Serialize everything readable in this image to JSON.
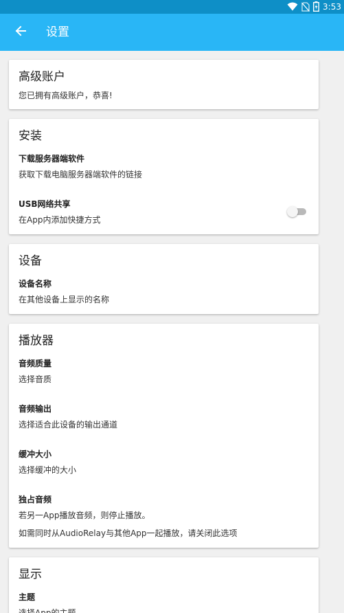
{
  "status_bar": {
    "time": "3:53",
    "icons": [
      "wifi-icon",
      "no-sim-icon",
      "battery-icon"
    ]
  },
  "app_bar": {
    "title": "设置",
    "back_icon": "arrow-left-icon"
  },
  "colors": {
    "status_bar": "#0e8fc7",
    "app_bar": "#29b6f6",
    "background": "#f0f0f0",
    "card": "#ffffff"
  },
  "sections": {
    "premium": {
      "title": "高级账户",
      "subtitle": "您已拥有高级账户，恭喜!"
    },
    "install": {
      "title": "安装",
      "download": {
        "title": "下载服务器端软件",
        "subtitle": "获取下载电脑服务器端软件的链接"
      },
      "usb": {
        "title": "USB网络共享",
        "subtitle": "在App内添加快捷方式",
        "enabled": false
      }
    },
    "device": {
      "title": "设备",
      "name": {
        "title": "设备名称",
        "subtitle": "在其他设备上显示的名称"
      }
    },
    "player": {
      "title": "播放器",
      "quality": {
        "title": "音频质量",
        "subtitle": "选择音质"
      },
      "output": {
        "title": "音频输出",
        "subtitle": "选择适合此设备的输出通道"
      },
      "buffer": {
        "title": "缓冲大小",
        "subtitle": "选择缓冲的大小"
      },
      "exclusive": {
        "title": "独占音频",
        "subtitle": "若另一App播放音频，则停止播放。",
        "note": "如需同时从AudioRelay与其他App一起播放，请关闭此选项"
      }
    },
    "display": {
      "title": "显示",
      "theme": {
        "title": "主题",
        "subtitle": "选择App的主题"
      }
    }
  }
}
